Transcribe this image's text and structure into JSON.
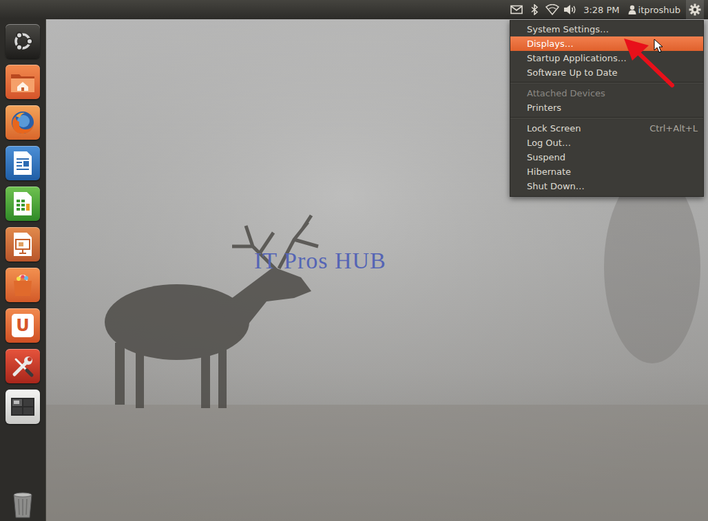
{
  "top_panel": {
    "indicators": [
      {
        "kind": "mail"
      },
      {
        "kind": "bluetooth"
      },
      {
        "kind": "network"
      },
      {
        "kind": "volume"
      }
    ],
    "clock": "3:28 PM",
    "user": "itproshub",
    "session_menu_open": true
  },
  "launcher": {
    "items": [
      {
        "kind": "dash"
      },
      {
        "kind": "home"
      },
      {
        "kind": "firefox"
      },
      {
        "kind": "writer"
      },
      {
        "kind": "calc"
      },
      {
        "kind": "impress"
      },
      {
        "kind": "software-center"
      },
      {
        "kind": "ubuntu-one",
        "glyph": "U"
      },
      {
        "kind": "system-settings"
      },
      {
        "kind": "workspaces"
      }
    ],
    "trash": {
      "kind": "trash"
    }
  },
  "session_menu": {
    "sections": [
      [
        {
          "label": "System Settings…",
          "selected": false,
          "disabled": false
        },
        {
          "label": "Displays…",
          "selected": true,
          "disabled": false
        },
        {
          "label": "Startup Applications…",
          "selected": false,
          "disabled": false
        },
        {
          "label": "Software Up to Date",
          "selected": false,
          "disabled": false
        }
      ],
      [
        {
          "label": "Attached Devices",
          "selected": false,
          "disabled": true
        },
        {
          "label": "Printers",
          "selected": false,
          "disabled": false
        }
      ],
      [
        {
          "label": "Lock Screen",
          "shortcut": "Ctrl+Alt+L",
          "selected": false,
          "disabled": false
        },
        {
          "label": "Log Out…",
          "selected": false,
          "disabled": false
        },
        {
          "label": "Suspend",
          "selected": false,
          "disabled": false
        },
        {
          "label": "Hibernate",
          "selected": false,
          "disabled": false
        },
        {
          "label": "Shut Down…",
          "selected": false,
          "disabled": false
        }
      ]
    ]
  },
  "watermark": "IT Pros HUB"
}
